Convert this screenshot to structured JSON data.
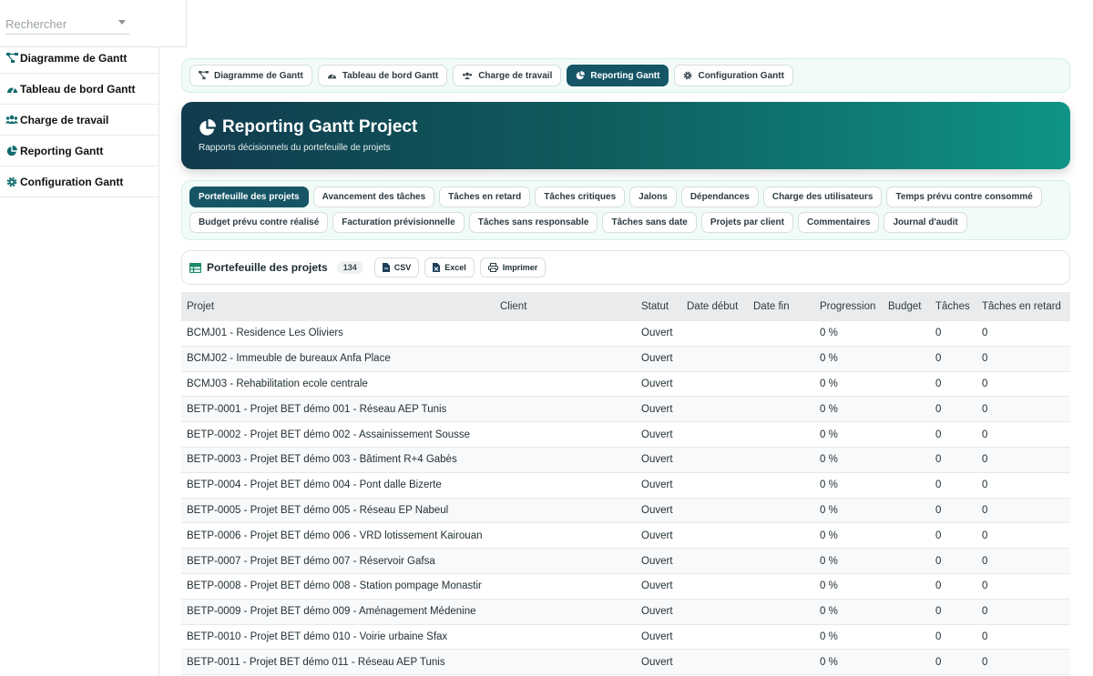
{
  "search": {
    "placeholder": "Rechercher"
  },
  "sidebar": {
    "items": [
      {
        "label": "Diagramme de Gantt",
        "icon": "diagram-icon"
      },
      {
        "label": "Tableau de bord Gantt",
        "icon": "dashboard-icon"
      },
      {
        "label": "Charge de travail",
        "icon": "users-icon"
      },
      {
        "label": "Reporting Gantt",
        "icon": "chart-pie-icon"
      },
      {
        "label": "Configuration Gantt",
        "icon": "gear-icon"
      }
    ]
  },
  "tabs": [
    {
      "label": "Diagramme de Gantt",
      "icon": "diagram-icon",
      "active": false
    },
    {
      "label": "Tableau de bord Gantt",
      "icon": "dashboard-icon",
      "active": false
    },
    {
      "label": "Charge de travail",
      "icon": "users-icon",
      "active": false
    },
    {
      "label": "Reporting Gantt",
      "icon": "chart-pie-icon",
      "active": true
    },
    {
      "label": "Configuration Gantt",
      "icon": "gear-icon",
      "active": false
    }
  ],
  "hero": {
    "title": "Reporting Gantt Project",
    "subtitle": "Rapports décisionnels du portefeuille de projets"
  },
  "reports": {
    "row1": [
      "Portefeuille des projets",
      "Avancement des tâches",
      "Tâches en retard",
      "Tâches critiques",
      "Jalons",
      "Dépendances",
      "Charge des utilisateurs",
      "Temps prévu contre consommé"
    ],
    "row2": [
      "Budget prévu contre réalisé",
      "Facturation prévisionnelle",
      "Tâches sans responsable",
      "Tâches sans date",
      "Projets par client",
      "Commentaires",
      "Journal d'audit"
    ]
  },
  "toolbar": {
    "title": "Portefeuille des projets",
    "count": "134",
    "csv": "CSV",
    "excel": "Excel",
    "print": "Imprimer"
  },
  "table": {
    "headers": {
      "projet": "Projet",
      "client": "Client",
      "statut": "Statut",
      "debut": "Date début",
      "fin": "Date fin",
      "progression": "Progression",
      "budget": "Budget",
      "taches": "Tâches",
      "retard": "Tâches en retard"
    },
    "rows": [
      {
        "projet": "BCMJ01 - Residence Les Oliviers",
        "client": "",
        "statut": "Ouvert",
        "debut": "",
        "fin": "",
        "progression": "0 %",
        "budget": "",
        "taches": "0",
        "retard": "0"
      },
      {
        "projet": "BCMJ02 - Immeuble de bureaux Anfa Place",
        "client": "",
        "statut": "Ouvert",
        "debut": "",
        "fin": "",
        "progression": "0 %",
        "budget": "",
        "taches": "0",
        "retard": "0"
      },
      {
        "projet": "BCMJ03 - Rehabilitation ecole centrale",
        "client": "",
        "statut": "Ouvert",
        "debut": "",
        "fin": "",
        "progression": "0 %",
        "budget": "",
        "taches": "0",
        "retard": "0"
      },
      {
        "projet": "BETP-0001 - Projet BET démo 001 - Réseau AEP Tunis",
        "client": "",
        "statut": "Ouvert",
        "debut": "",
        "fin": "",
        "progression": "0 %",
        "budget": "",
        "taches": "0",
        "retard": "0"
      },
      {
        "projet": "BETP-0002 - Projet BET démo 002 - Assainissement Sousse",
        "client": "",
        "statut": "Ouvert",
        "debut": "",
        "fin": "",
        "progression": "0 %",
        "budget": "",
        "taches": "0",
        "retard": "0"
      },
      {
        "projet": "BETP-0003 - Projet BET démo 003 - Bâtiment R+4 Gabès",
        "client": "",
        "statut": "Ouvert",
        "debut": "",
        "fin": "",
        "progression": "0 %",
        "budget": "",
        "taches": "0",
        "retard": "0"
      },
      {
        "projet": "BETP-0004 - Projet BET démo 004 - Pont dalle Bizerte",
        "client": "",
        "statut": "Ouvert",
        "debut": "",
        "fin": "",
        "progression": "0 %",
        "budget": "",
        "taches": "0",
        "retard": "0"
      },
      {
        "projet": "BETP-0005 - Projet BET démo 005 - Réseau EP Nabeul",
        "client": "",
        "statut": "Ouvert",
        "debut": "",
        "fin": "",
        "progression": "0 %",
        "budget": "",
        "taches": "0",
        "retard": "0"
      },
      {
        "projet": "BETP-0006 - Projet BET démo 006 - VRD lotissement Kairouan",
        "client": "",
        "statut": "Ouvert",
        "debut": "",
        "fin": "",
        "progression": "0 %",
        "budget": "",
        "taches": "0",
        "retard": "0"
      },
      {
        "projet": "BETP-0007 - Projet BET démo 007 - Réservoir Gafsa",
        "client": "",
        "statut": "Ouvert",
        "debut": "",
        "fin": "",
        "progression": "0 %",
        "budget": "",
        "taches": "0",
        "retard": "0"
      },
      {
        "projet": "BETP-0008 - Projet BET démo 008 - Station pompage Monastir",
        "client": "",
        "statut": "Ouvert",
        "debut": "",
        "fin": "",
        "progression": "0 %",
        "budget": "",
        "taches": "0",
        "retard": "0"
      },
      {
        "projet": "BETP-0009 - Projet BET démo 009 - Aménagement Médenine",
        "client": "",
        "statut": "Ouvert",
        "debut": "",
        "fin": "",
        "progression": "0 %",
        "budget": "",
        "taches": "0",
        "retard": "0"
      },
      {
        "projet": "BETP-0010 - Projet BET démo 010 - Voirie urbaine Sfax",
        "client": "",
        "statut": "Ouvert",
        "debut": "",
        "fin": "",
        "progression": "0 %",
        "budget": "",
        "taches": "0",
        "retard": "0"
      },
      {
        "projet": "BETP-0011 - Projet BET démo 011 - Réseau AEP Tunis",
        "client": "",
        "statut": "Ouvert",
        "debut": "",
        "fin": "",
        "progression": "0 %",
        "budget": "",
        "taches": "0",
        "retard": "0"
      }
    ]
  },
  "colors": {
    "accent": "#155565",
    "hero_start": "#113b4e",
    "hero_end": "#0f9486",
    "panel_bg": "#f1fbf8"
  }
}
